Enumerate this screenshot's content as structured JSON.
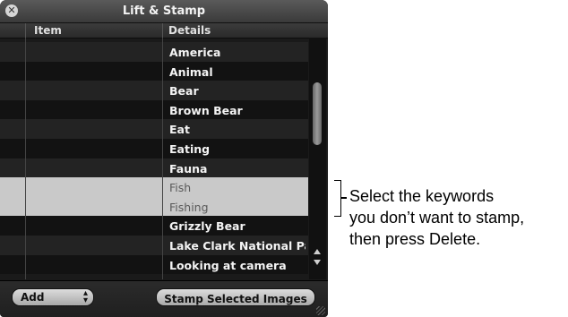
{
  "window": {
    "title": "Lift & Stamp"
  },
  "table": {
    "columns": [
      "Item",
      "Details"
    ],
    "rows": [
      {
        "details": "America",
        "selected": false
      },
      {
        "details": "Animal",
        "selected": false
      },
      {
        "details": "Bear",
        "selected": false
      },
      {
        "details": "Brown Bear",
        "selected": false
      },
      {
        "details": "Eat",
        "selected": false
      },
      {
        "details": "Eating",
        "selected": false
      },
      {
        "details": "Fauna",
        "selected": false
      },
      {
        "details": "Fish",
        "selected": true
      },
      {
        "details": "Fishing",
        "selected": true
      },
      {
        "details": "Grizzly Bear",
        "selected": false
      },
      {
        "details": "Lake Clark National Par",
        "selected": false
      },
      {
        "details": "Looking at camera",
        "selected": false
      }
    ]
  },
  "toolbar": {
    "add_label": "Add",
    "stamp_label": "Stamp Selected Images"
  },
  "callout": {
    "lines": [
      "Select the keywords",
      "you don’t want to stamp,",
      "then press Delete."
    ]
  },
  "icons": {
    "close": "close-icon",
    "scroll_up": "scroll-up-arrow-icon",
    "scroll_down": "scroll-down-arrow-icon",
    "popup": "up-down-chevron-icon",
    "resize": "resize-grip-icon"
  },
  "colors": {
    "row_dark": "#121212",
    "row_light": "#232323",
    "row_selected": "#c9c9c9",
    "text_normal": "#f4f4f4",
    "text_selected": "#5a5a5a"
  }
}
